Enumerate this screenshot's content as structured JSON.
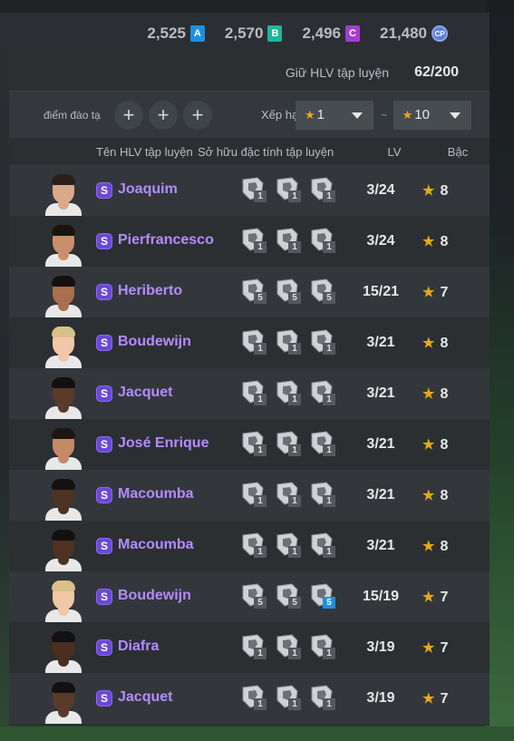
{
  "currencies": [
    {
      "value": "2,525",
      "badge": "A",
      "color": "#1e8fe0"
    },
    {
      "value": "2,570",
      "badge": "B",
      "color": "#1fb59a"
    },
    {
      "value": "2,496",
      "badge": "C",
      "color": "#a43ccc"
    },
    {
      "value": "21,480",
      "badge": "CP",
      "color": "#5c7fd6"
    }
  ],
  "hold": {
    "label": "Giữ HLV tập luyện",
    "value": "62/200"
  },
  "filter": {
    "points_label": "điểm đào tạ",
    "plus": "+",
    "rank_label": "Xếp hạ",
    "rank_from": "1",
    "rank_to": "10",
    "tilde": "~"
  },
  "headers": {
    "name": "Tên HLV tập luyện",
    "traits": "Sở hữu đặc tính tập luyện",
    "lv": "LV",
    "rank": "Bậc"
  },
  "accent": {
    "star": "#e6a81a",
    "name": "#b48cff",
    "badge": "#6a48d6"
  },
  "coaches": [
    {
      "name": "Joaquim",
      "lv": "3/24",
      "rank": "8",
      "traits": [
        {
          "icon": "shield-gear-icon",
          "lvl": "1"
        },
        {
          "icon": "boot-ball-icon",
          "lvl": "1"
        },
        {
          "icon": "player-arms-icon",
          "lvl": "1"
        }
      ]
    },
    {
      "name": "Pierfrancesco",
      "lv": "3/24",
      "rank": "8",
      "traits": [
        {
          "icon": "boot-ball-icon",
          "lvl": "1"
        },
        {
          "icon": "target-shield-icon",
          "lvl": "1"
        },
        {
          "icon": "player-arms-icon",
          "lvl": "1"
        }
      ]
    },
    {
      "name": "Heriberto",
      "lv": "15/21",
      "rank": "7",
      "traits": [
        {
          "icon": "boot-ball-icon",
          "lvl": "5"
        },
        {
          "icon": "goal-net-icon",
          "lvl": "5"
        },
        {
          "icon": "player-arms-icon",
          "lvl": "5"
        }
      ]
    },
    {
      "name": "Boudewijn",
      "lv": "3/21",
      "rank": "8",
      "traits": [
        {
          "icon": "player-arms-icon",
          "lvl": "1"
        },
        {
          "icon": "swirl-ball-icon",
          "lvl": "1"
        },
        {
          "icon": "shield-arrow-icon",
          "lvl": "1"
        }
      ]
    },
    {
      "name": "Jacquet",
      "lv": "3/21",
      "rank": "8",
      "traits": [
        {
          "icon": "goal-net-icon",
          "lvl": "1"
        },
        {
          "icon": "player-arms-icon",
          "lvl": "1"
        },
        {
          "icon": "runner-icon",
          "lvl": "1"
        }
      ]
    },
    {
      "name": "José Enrique",
      "lv": "3/21",
      "rank": "8",
      "traits": [
        {
          "icon": "player-arms-icon",
          "lvl": "1"
        },
        {
          "icon": "kick-player-icon",
          "lvl": "1"
        },
        {
          "icon": "shield-pen-icon",
          "lvl": "1"
        }
      ]
    },
    {
      "name": "Macoumba",
      "lv": "3/21",
      "rank": "8",
      "traits": [
        {
          "icon": "shield-gear-icon",
          "lvl": "1"
        },
        {
          "icon": "player-arms-icon",
          "lvl": "1"
        },
        {
          "icon": "runner-icon",
          "lvl": "1"
        }
      ]
    },
    {
      "name": "Macoumba",
      "lv": "3/21",
      "rank": "8",
      "traits": [
        {
          "icon": "shield-gear-icon",
          "lvl": "1"
        },
        {
          "icon": "player-arms-icon",
          "lvl": "1"
        },
        {
          "icon": "runner-icon",
          "lvl": "1"
        }
      ]
    },
    {
      "name": "Boudewijn",
      "lv": "15/19",
      "rank": "7",
      "traits": [
        {
          "icon": "player-arms-icon",
          "lvl": "5"
        },
        {
          "icon": "swirl-ball-icon",
          "lvl": "5"
        },
        {
          "icon": "target-shield-icon",
          "lvl": "5",
          "highlight": true
        }
      ]
    },
    {
      "name": "Diafra",
      "lv": "3/19",
      "rank": "7",
      "traits": [
        {
          "icon": "target-shield-icon",
          "lvl": "1"
        },
        {
          "icon": "player-arms-icon",
          "lvl": "1"
        },
        {
          "icon": "runner-icon",
          "lvl": "1"
        }
      ]
    },
    {
      "name": "Jacquet",
      "lv": "3/19",
      "rank": "7",
      "traits": [
        {
          "icon": "target-shield-icon",
          "lvl": "1"
        },
        {
          "icon": "player-arms-icon",
          "lvl": "1"
        },
        {
          "icon": "goal-net-icon",
          "lvl": "1"
        }
      ]
    }
  ]
}
